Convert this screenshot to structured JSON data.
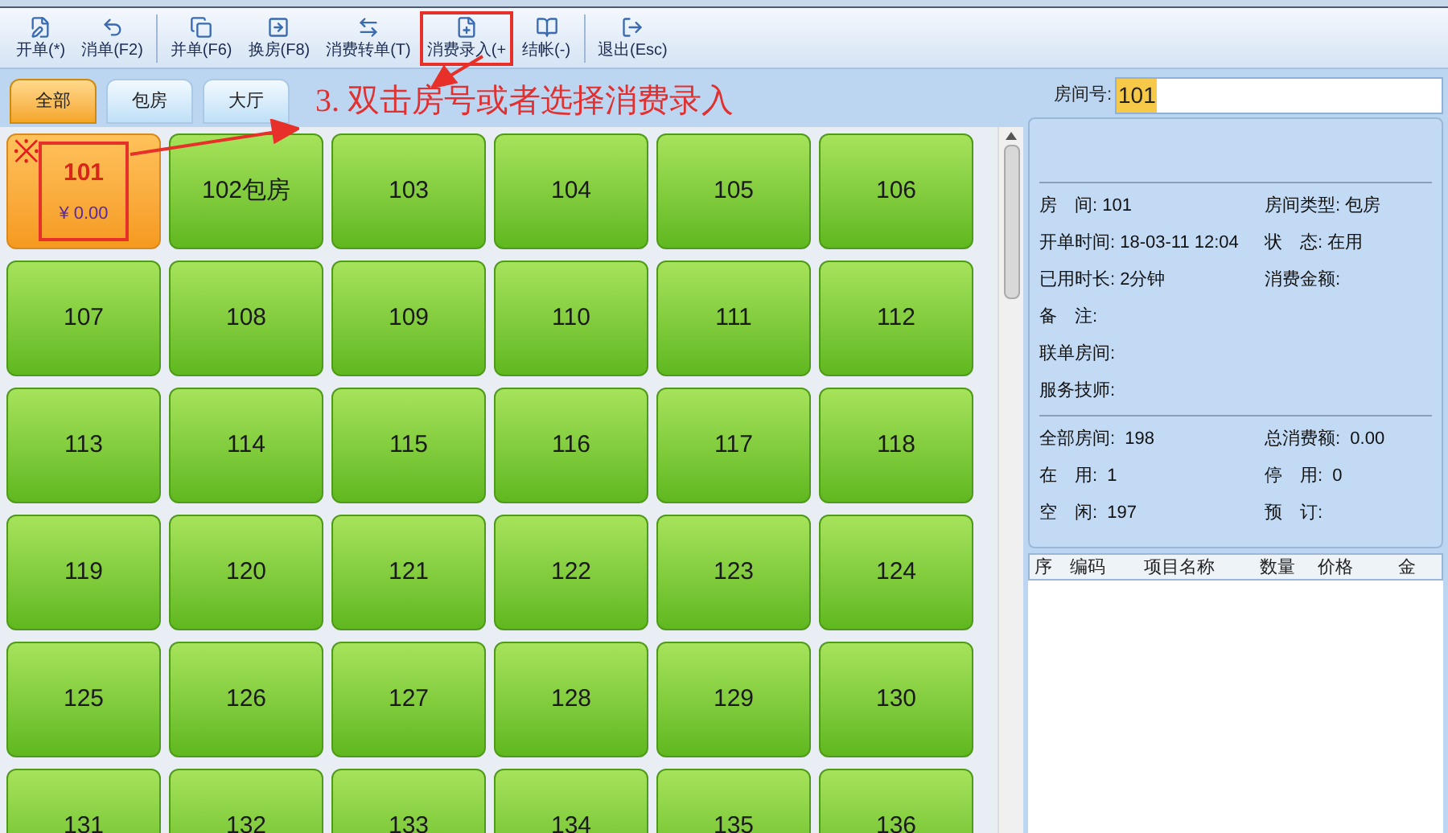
{
  "toolbar": [
    {
      "label": "开单(*)",
      "kind": "edit",
      "sep": false,
      "highlighted": false
    },
    {
      "label": "消单(F2)",
      "kind": "undo",
      "sep": true,
      "highlighted": false
    },
    {
      "label": "并单(F6)",
      "kind": "merge",
      "sep": false,
      "highlighted": false
    },
    {
      "label": "换房(F8)",
      "kind": "swap",
      "sep": false,
      "highlighted": false
    },
    {
      "label": "消费转单(T)",
      "kind": "transfer",
      "sep": false,
      "highlighted": false
    },
    {
      "label": "消费录入(+",
      "kind": "entry",
      "sep": false,
      "highlighted": true
    },
    {
      "label": "结帐(-)",
      "kind": "checkout",
      "sep": true,
      "highlighted": false
    },
    {
      "label": "退出(Esc)",
      "kind": "exit",
      "sep": false,
      "highlighted": false
    }
  ],
  "tabs": [
    {
      "label": "全部",
      "selected": true
    },
    {
      "label": "包房",
      "selected": false
    },
    {
      "label": "大厅",
      "selected": false
    }
  ],
  "annotation": {
    "text": "3. 双击房号或者选择消费录入"
  },
  "rooms": [
    {
      "number": "101",
      "selected": true,
      "highlighted": true,
      "amount": "¥ 0.00",
      "mark": "※"
    },
    {
      "number": "102包房",
      "selected": false
    },
    {
      "number": "103",
      "selected": false
    },
    {
      "number": "104",
      "selected": false
    },
    {
      "number": "105",
      "selected": false
    },
    {
      "number": "106",
      "selected": false
    },
    {
      "number": "107",
      "selected": false
    },
    {
      "number": "108",
      "selected": false
    },
    {
      "number": "109",
      "selected": false
    },
    {
      "number": "110",
      "selected": false
    },
    {
      "number": "111",
      "selected": false
    },
    {
      "number": "112",
      "selected": false
    },
    {
      "number": "113",
      "selected": false
    },
    {
      "number": "114",
      "selected": false
    },
    {
      "number": "115",
      "selected": false
    },
    {
      "number": "116",
      "selected": false
    },
    {
      "number": "117",
      "selected": false
    },
    {
      "number": "118",
      "selected": false
    },
    {
      "number": "119",
      "selected": false
    },
    {
      "number": "120",
      "selected": false
    },
    {
      "number": "121",
      "selected": false
    },
    {
      "number": "122",
      "selected": false
    },
    {
      "number": "123",
      "selected": false
    },
    {
      "number": "124",
      "selected": false
    },
    {
      "number": "125",
      "selected": false
    },
    {
      "number": "126",
      "selected": false
    },
    {
      "number": "127",
      "selected": false
    },
    {
      "number": "128",
      "selected": false
    },
    {
      "number": "129",
      "selected": false
    },
    {
      "number": "130",
      "selected": false
    },
    {
      "number": "131",
      "selected": false
    },
    {
      "number": "132",
      "selected": false
    },
    {
      "number": "133",
      "selected": false
    },
    {
      "number": "134",
      "selected": false
    },
    {
      "number": "135",
      "selected": false
    },
    {
      "number": "136",
      "selected": false
    }
  ],
  "room_field": {
    "label": "房间号:",
    "value": "101"
  },
  "details": [
    {
      "left": "房　间: 101",
      "right": "房间类型: 包房"
    },
    {
      "left": "开单时间: 18-03-11 12:04",
      "right": "状　态: 在用"
    },
    {
      "left": "已用时长: 2分钟",
      "right": "消费金额:"
    },
    {
      "left": "备　注:"
    },
    {
      "left": "联单房间:"
    },
    {
      "left": "服务技师:"
    }
  ],
  "summary": [
    {
      "left": "全部房间:  198",
      "right": "总消费额:  0.00"
    },
    {
      "left": "在　用:  1",
      "right": "停　用:  0"
    },
    {
      "left": "空　闲:  197",
      "right": "预　订:"
    }
  ],
  "table": {
    "columns": [
      "序",
      "编码",
      "项目名称",
      "数量",
      "价格",
      "金"
    ]
  }
}
